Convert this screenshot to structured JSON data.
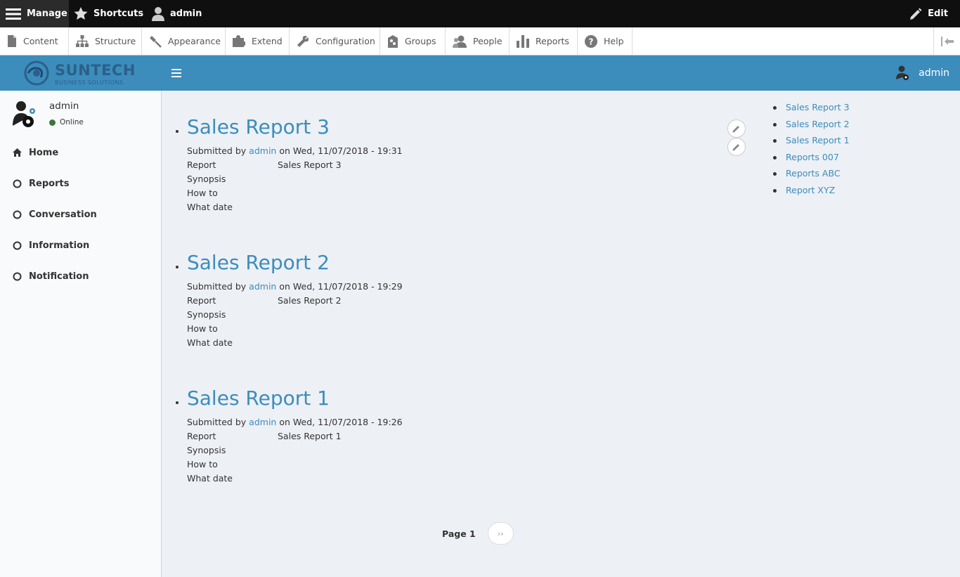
{
  "toolbar": {
    "manage": "Manage",
    "shortcuts": "Shortcuts",
    "user": "admin",
    "edit": "Edit"
  },
  "tray": {
    "items": [
      {
        "label": "Content",
        "icon": "file-icon"
      },
      {
        "label": "Structure",
        "icon": "sitemap-icon"
      },
      {
        "label": "Appearance",
        "icon": "paintbrush-icon"
      },
      {
        "label": "Extend",
        "icon": "puzzle-icon"
      },
      {
        "label": "Configuration",
        "icon": "wrench-icon"
      },
      {
        "label": "Groups",
        "icon": "groups-icon"
      },
      {
        "label": "People",
        "icon": "people-icon"
      },
      {
        "label": "Reports",
        "icon": "bar-chart-icon"
      },
      {
        "label": "Help",
        "icon": "help-icon"
      }
    ]
  },
  "header": {
    "logo_title": "SUNTECH",
    "logo_subtitle": "BUSINESS SOLUTIONS",
    "user": "admin"
  },
  "sidebar": {
    "user_name": "admin",
    "status": "Online",
    "items": [
      {
        "label": "Home",
        "icon": "home-icon"
      },
      {
        "label": "Reports",
        "icon": "circle-icon"
      },
      {
        "label": "Conversation",
        "icon": "circle-icon"
      },
      {
        "label": "Information",
        "icon": "circle-icon"
      },
      {
        "label": "Notification",
        "icon": "circle-icon"
      }
    ]
  },
  "nodes": [
    {
      "title": "Sales Report 3",
      "submitted_prefix": "Submitted by",
      "author": "admin",
      "submitted_suffix": "on Wed, 11/07/2018 - 19:31",
      "fields": [
        {
          "label": "Report",
          "value": "Sales Report 3"
        },
        {
          "label": "Synopsis",
          "value": ""
        },
        {
          "label": "How to",
          "value": ""
        },
        {
          "label": "What date",
          "value": ""
        }
      ]
    },
    {
      "title": "Sales Report 2",
      "submitted_prefix": "Submitted by",
      "author": "admin",
      "submitted_suffix": "on Wed, 11/07/2018 - 19:29",
      "fields": [
        {
          "label": "Report",
          "value": "Sales Report 2"
        },
        {
          "label": "Synopsis",
          "value": ""
        },
        {
          "label": "How to",
          "value": ""
        },
        {
          "label": "What date",
          "value": ""
        }
      ]
    },
    {
      "title": "Sales Report 1",
      "submitted_prefix": "Submitted by",
      "author": "admin",
      "submitted_suffix": "on Wed, 11/07/2018 - 19:26",
      "fields": [
        {
          "label": "Report",
          "value": "Sales Report 1"
        },
        {
          "label": "Synopsis",
          "value": ""
        },
        {
          "label": "How to",
          "value": ""
        },
        {
          "label": "What date",
          "value": ""
        }
      ]
    }
  ],
  "side_links": [
    "Sales Report 3",
    "Sales Report 2",
    "Sales Report 1",
    "Reports 007",
    "Reports ABC",
    "Report XYZ"
  ],
  "pager": {
    "label": "Page 1",
    "next": "››"
  }
}
